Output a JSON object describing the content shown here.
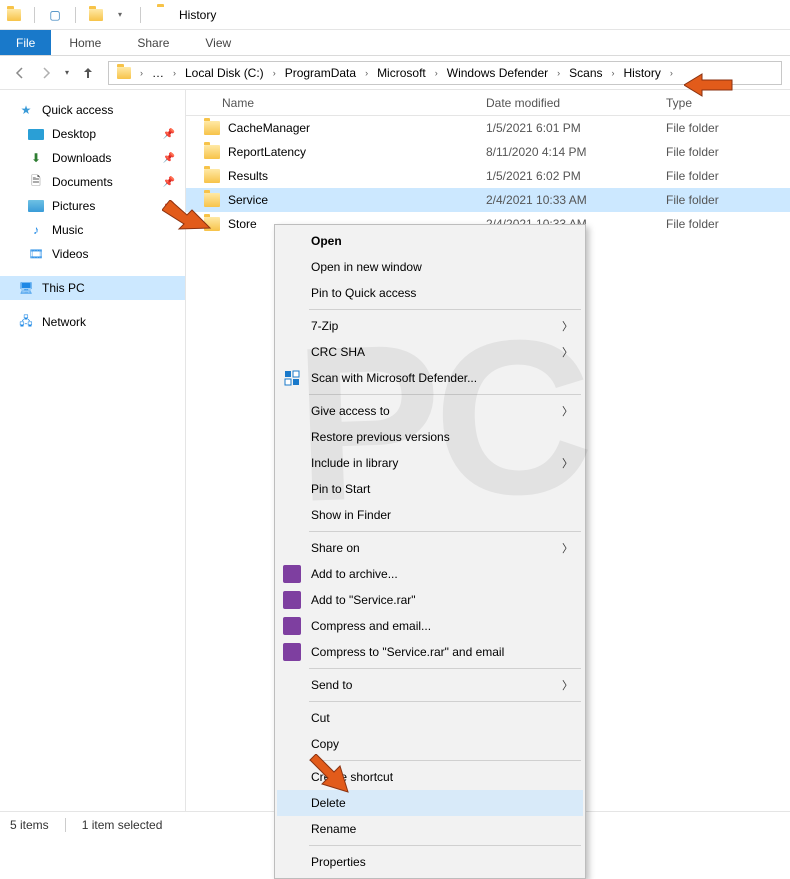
{
  "window": {
    "title": "History"
  },
  "ribbon": {
    "file": "File",
    "tabs": [
      "Home",
      "Share",
      "View"
    ]
  },
  "breadcrumb": {
    "segments": [
      "Local Disk (C:)",
      "ProgramData",
      "Microsoft",
      "Windows Defender",
      "Scans",
      "History"
    ]
  },
  "sidebar": {
    "quick_access": "Quick access",
    "items": [
      {
        "label": "Desktop",
        "pinned": true,
        "icon": "desktop"
      },
      {
        "label": "Downloads",
        "pinned": true,
        "icon": "downloads"
      },
      {
        "label": "Documents",
        "pinned": true,
        "icon": "documents"
      },
      {
        "label": "Pictures",
        "pinned": true,
        "icon": "pictures"
      },
      {
        "label": "Music",
        "pinned": false,
        "icon": "music"
      },
      {
        "label": "Videos",
        "pinned": false,
        "icon": "videos"
      }
    ],
    "this_pc": "This PC",
    "network": "Network"
  },
  "columns": {
    "name": "Name",
    "date": "Date modified",
    "type": "Type"
  },
  "rows": [
    {
      "name": "CacheManager",
      "date": "1/5/2021 6:01 PM",
      "type": "File folder",
      "selected": false
    },
    {
      "name": "ReportLatency",
      "date": "8/11/2020 4:14 PM",
      "type": "File folder",
      "selected": false
    },
    {
      "name": "Results",
      "date": "1/5/2021 6:02 PM",
      "type": "File folder",
      "selected": false
    },
    {
      "name": "Service",
      "date": "2/4/2021 10:33 AM",
      "type": "File folder",
      "selected": true
    },
    {
      "name": "Store",
      "date": "2/4/2021 10:33 AM",
      "type": "File folder",
      "selected": false
    }
  ],
  "status": {
    "count": "5 items",
    "selected": "1 item selected"
  },
  "context_menu": {
    "open": "Open",
    "open_new": "Open in new window",
    "pin_quick": "Pin to Quick access",
    "seven_zip": "7-Zip",
    "crc": "CRC SHA",
    "defender": "Scan with Microsoft Defender...",
    "give_access": "Give access to",
    "restore": "Restore previous versions",
    "include": "Include in library",
    "pin_start": "Pin to Start",
    "finder": "Show in Finder",
    "share_on": "Share on",
    "add_archive": "Add to archive...",
    "add_rar": "Add to \"Service.rar\"",
    "compress_email": "Compress and email...",
    "compress_rar_email": "Compress to \"Service.rar\" and email",
    "send_to": "Send to",
    "cut": "Cut",
    "copy": "Copy",
    "create_shortcut": "Create shortcut",
    "delete": "Delete",
    "rename": "Rename",
    "properties": "Properties"
  }
}
